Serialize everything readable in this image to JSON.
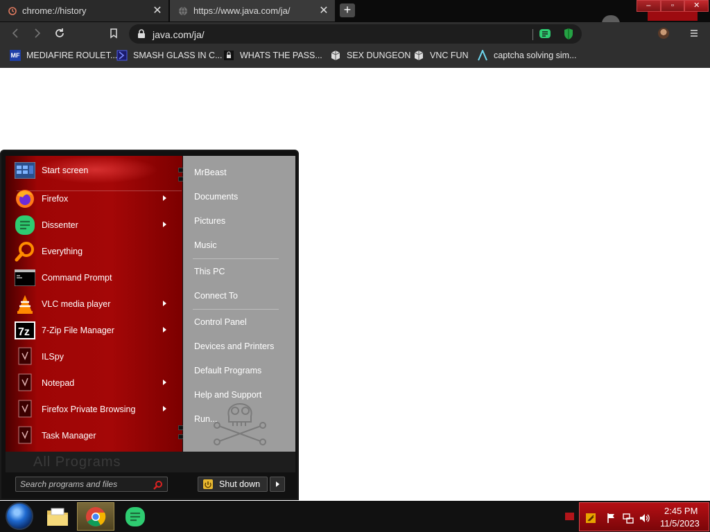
{
  "browser": {
    "tabs": [
      {
        "title": "chrome://history",
        "icon": "history-icon"
      },
      {
        "title": "https://www.java.com/ja/",
        "icon": "globe-icon"
      }
    ],
    "url": "java.com/ja/",
    "bookmarks": [
      {
        "label": "MEDIAFIRE ROULET...",
        "icon": "mediafire-icon",
        "icon_text": "MF"
      },
      {
        "label": "SMASH GLASS IN C...",
        "icon": "smash-glass-icon",
        "icon_text": ""
      },
      {
        "label": "WHATS THE PASS...",
        "icon": "lock-site-icon",
        "icon_text": ""
      },
      {
        "label": "SEX DUNGEON",
        "icon": "cube-icon",
        "icon_text": ""
      },
      {
        "label": "VNC FUN",
        "icon": "cube-icon",
        "icon_text": ""
      },
      {
        "label": "captcha solving sim...",
        "icon": "arrow-logo-icon",
        "icon_text": ""
      }
    ]
  },
  "start_menu": {
    "items": [
      {
        "label": "Start screen",
        "icon": "start-screen-icon",
        "submenu": false
      },
      {
        "label": "Firefox",
        "icon": "firefox-icon",
        "submenu": true
      },
      {
        "label": "Dissenter",
        "icon": "dissenter-icon",
        "submenu": true
      },
      {
        "label": "Everything",
        "icon": "magnifier-icon",
        "submenu": false
      },
      {
        "label": "Command Prompt",
        "icon": "cmd-icon",
        "submenu": false
      },
      {
        "label": "VLC media player",
        "icon": "vlc-icon",
        "submenu": true
      },
      {
        "label": "7-Zip File Manager",
        "icon": "7zip-icon",
        "submenu": true
      },
      {
        "label": "ILSpy",
        "icon": "app-icon",
        "submenu": false
      },
      {
        "label": "Notepad",
        "icon": "app-icon",
        "submenu": true
      },
      {
        "label": "Firefox Private Browsing",
        "icon": "app-icon",
        "submenu": true
      },
      {
        "label": "Task Manager",
        "icon": "app-icon",
        "submenu": false
      }
    ],
    "right_items": [
      "MrBeast",
      "Documents",
      "Pictures",
      "Music",
      "This PC",
      "Connect To",
      "Control Panel",
      "Devices and Printers",
      "Default Programs",
      "Help and Support",
      "Run..."
    ],
    "all_programs": "All Programs",
    "search_placeholder": "Search programs and files",
    "shutdown_label": "Shut down"
  },
  "taskbar": {
    "time": "2:45 PM",
    "date": "11/5/2023"
  },
  "colors": {
    "menu_red": "#a40707",
    "right_panel": "#9d9d9d",
    "tray_red": "#b50f14"
  }
}
